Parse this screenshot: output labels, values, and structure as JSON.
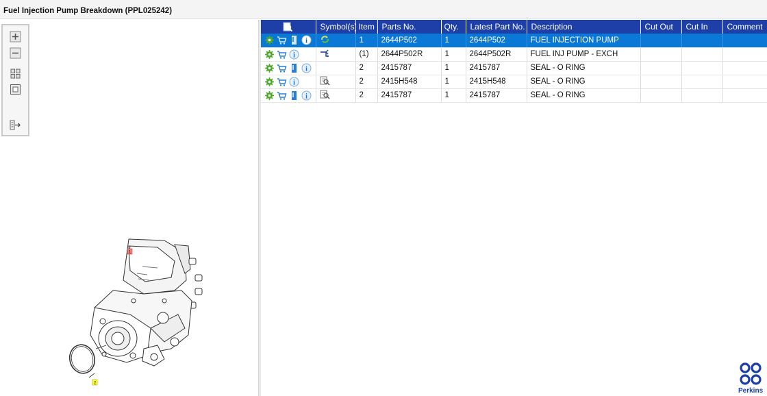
{
  "window": {
    "title": "Fuel Injection Pump Breakdown (PPL025242)"
  },
  "toolbar": {
    "buttons": [
      {
        "name": "zoom-in-icon"
      },
      {
        "name": "zoom-out-icon"
      },
      {
        "name": "fit-all-icon"
      },
      {
        "name": "fit-window-icon"
      },
      {
        "name": "export-list-icon"
      }
    ]
  },
  "drawing": {
    "callouts": [
      "1",
      "2"
    ]
  },
  "table": {
    "headers": [
      "",
      "Symbol(s)",
      "Item",
      "Parts No.",
      "Qty.",
      "Latest Part No.",
      "Description",
      "Cut Out",
      "Cut In",
      "Comment"
    ],
    "rows": [
      {
        "item": "1",
        "parts_no": "2644P502",
        "qty": "1",
        "latest": "2644P502",
        "description": "FUEL INJECTION PUMP",
        "cut_out": "",
        "cut_in": "",
        "comment": ""
      },
      {
        "item": "(1)",
        "parts_no": "2644P502R",
        "qty": "1",
        "latest": "2644P502R",
        "description": "FUEL INJ PUMP - EXCH",
        "cut_out": "",
        "cut_in": "",
        "comment": ""
      },
      {
        "item": "2",
        "parts_no": "2415787",
        "qty": "1",
        "latest": "2415787",
        "description": "SEAL - O RING",
        "cut_out": "",
        "cut_in": "",
        "comment": ""
      },
      {
        "item": "2",
        "parts_no": "2415H548",
        "qty": "1",
        "latest": "2415H548",
        "description": "SEAL - O RING",
        "cut_out": "",
        "cut_in": "",
        "comment": ""
      },
      {
        "item": "2",
        "parts_no": "2415787",
        "qty": "1",
        "latest": "2415787",
        "description": "SEAL - O RING",
        "cut_out": "",
        "cut_in": "",
        "comment": ""
      }
    ]
  },
  "brand": {
    "name": "Perkins",
    "color": "#1f3fa8"
  },
  "colors": {
    "header": "#1f3fa8",
    "selected_row": "#0a78d7",
    "gear": "#4caa2a",
    "cart": "#2a7fd4"
  }
}
